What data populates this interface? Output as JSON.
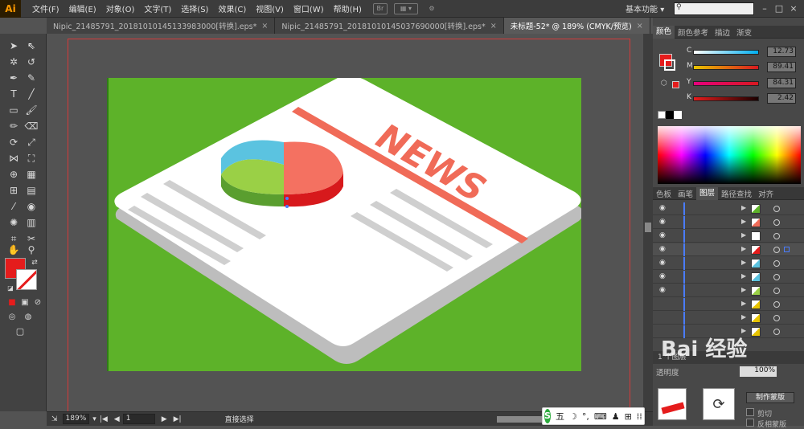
{
  "app": {
    "logo": "Ai"
  },
  "menu": [
    "文件(F)",
    "编辑(E)",
    "对象(O)",
    "文字(T)",
    "选择(S)",
    "效果(C)",
    "视图(V)",
    "窗口(W)",
    "帮助(H)"
  ],
  "menubar_icons": [
    "Br",
    "▦ ▾",
    "⚙"
  ],
  "workspace": {
    "label": "基本功能",
    "arrow": "▾"
  },
  "search": {
    "placeholder": ""
  },
  "tabs": [
    {
      "label": "Nipic_21485791_20181010145133983000[转换].eps*",
      "close": "×"
    },
    {
      "label": "Nipic_21485791_20181010145037690000[转换].eps*",
      "close": "×"
    },
    {
      "label": "未标题-52* @ 189% (CMYK/预览)",
      "close": "×"
    }
  ],
  "artwork": {
    "headline": "NEWS",
    "bg_color": "#5db229",
    "accent_color": "#f06b58"
  },
  "color_panel": {
    "tabs": [
      "颜色",
      "颜色参考",
      "描边",
      "渐变"
    ],
    "channels": [
      {
        "label": "C",
        "value": "12.73"
      },
      {
        "label": "M",
        "value": "89.41"
      },
      {
        "label": "Y",
        "value": "84.31"
      },
      {
        "label": "K",
        "value": "2.42"
      }
    ],
    "fill_color": "#e51c1c"
  },
  "layers_panel": {
    "tabs": [
      "色板",
      "画笔",
      "图层",
      "路径查找",
      "对齐"
    ],
    "row_count": 10,
    "footer": "1 个图层"
  },
  "transparency_panel": {
    "tab": "透明度",
    "opacity": "100%",
    "make_mask": "制作蒙版",
    "clip": "剪切",
    "invert_mask": "反相蒙版"
  },
  "watermark": {
    "text": "Bai 经验"
  },
  "status": {
    "zoom": "189%",
    "zoom_arrow": "▾",
    "nav_first": "|◀",
    "nav_prev": "◀",
    "page": "1",
    "nav_next": "▶",
    "nav_last": "▶|",
    "tool": "直接选择"
  },
  "ime": {
    "logo": "S",
    "mode": "五",
    "moon": "☽",
    "dot": "°,",
    "keyboard": "⌨",
    "user": "♟",
    "shirt": "⊞",
    "grid": "⁞⁞"
  }
}
